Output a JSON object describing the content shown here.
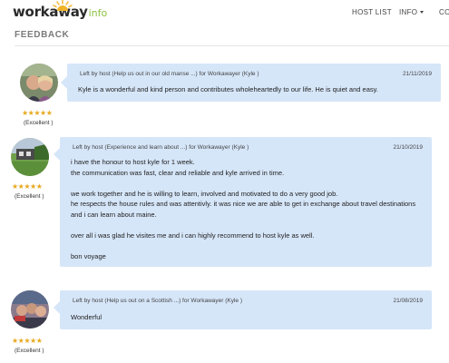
{
  "header": {
    "logo_main": "workaway",
    "logo_sub": "info",
    "nav": [
      {
        "label": "HOST LIST"
      },
      {
        "label": "INFO"
      },
      {
        "label": "CO"
      }
    ]
  },
  "section": {
    "title": "FEEDBACK"
  },
  "reviews": [
    {
      "heading": "Left by host (Help us out in our old manse ...) for Workawayer (Kyle )",
      "date": "21/11/2019",
      "text": "Kyle is a wonderful and kind person and contributes wholeheartedly to our life. He is quiet and easy.",
      "rating_label": "(Excellent )",
      "stars": 5
    },
    {
      "heading": "Left by host (Experience and learn about ...) for Workawayer (Kyle )",
      "date": "21/10/2019",
      "text": "i have the honour to host kyle for 1 week.\nthe communication was fast, clear and reliable and kyle arrived in time.\n\nwe work together and he is willing to learn, involved and motivated to do a very good job.\nhe respects the house rules and was attentivly. it was nice we are able to get in exchange about travel destinations and i can learn about maine.\n\nover all i was glad he visites me and i can highly recommend to host kyle as well.\n\nbon voyage",
      "rating_label": "(Excellent )",
      "stars": 5
    },
    {
      "heading": "Left by host (Help us out on a Scottish ...) for Workawayer (Kyle )",
      "date": "21/08/2019",
      "text": "Wonderful",
      "rating_label": "(Excellent )",
      "stars": 5
    }
  ],
  "colors": {
    "bubble": "#d6e6f9",
    "stars": "#e8a81e",
    "logo_accent": "#8cc13f"
  }
}
